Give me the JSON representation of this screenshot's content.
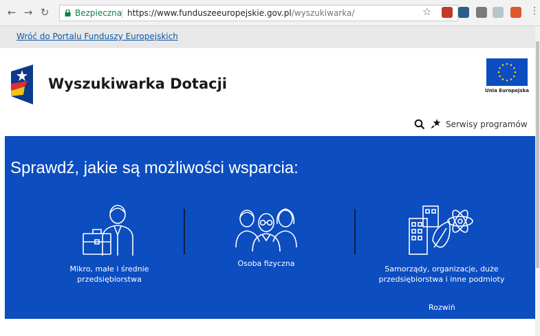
{
  "browser": {
    "back_icon": "arrow-left-icon",
    "forward_icon": "arrow-right-icon",
    "reload_icon": "reload-icon",
    "secure_label": "Bezpieczna",
    "url_host": "https://www.funduszeeuropejskie.gov.pl",
    "url_path": "/wyszukiwarka/",
    "star_icon": "bookmark-star-icon",
    "menu_icon": "menu-dots-icon",
    "colors": {
      "secure": "#0b8043"
    }
  },
  "portal": {
    "return_link": "Wróć do Portalu Funduszy Europejskich"
  },
  "header": {
    "title": "Wyszukiwarka Dotacji",
    "eu_label": "Unia Europejska",
    "services_label": "Serwisy programów"
  },
  "hero": {
    "title": "Sprawdź, jakie są możliwości wsparcia:",
    "background": "#0c4dc0",
    "cards": [
      {
        "label_line1": "Mikro, małe i średnie",
        "label_line2": "przedsiębiorstwa"
      },
      {
        "label_line1": "Osoba fizyczna",
        "label_line2": ""
      },
      {
        "label_line1": "Samorządy, organizacje, duże",
        "label_line2": "przedsiębiorstwa i inne podmioty"
      }
    ],
    "expand_label": "Rozwiń"
  }
}
